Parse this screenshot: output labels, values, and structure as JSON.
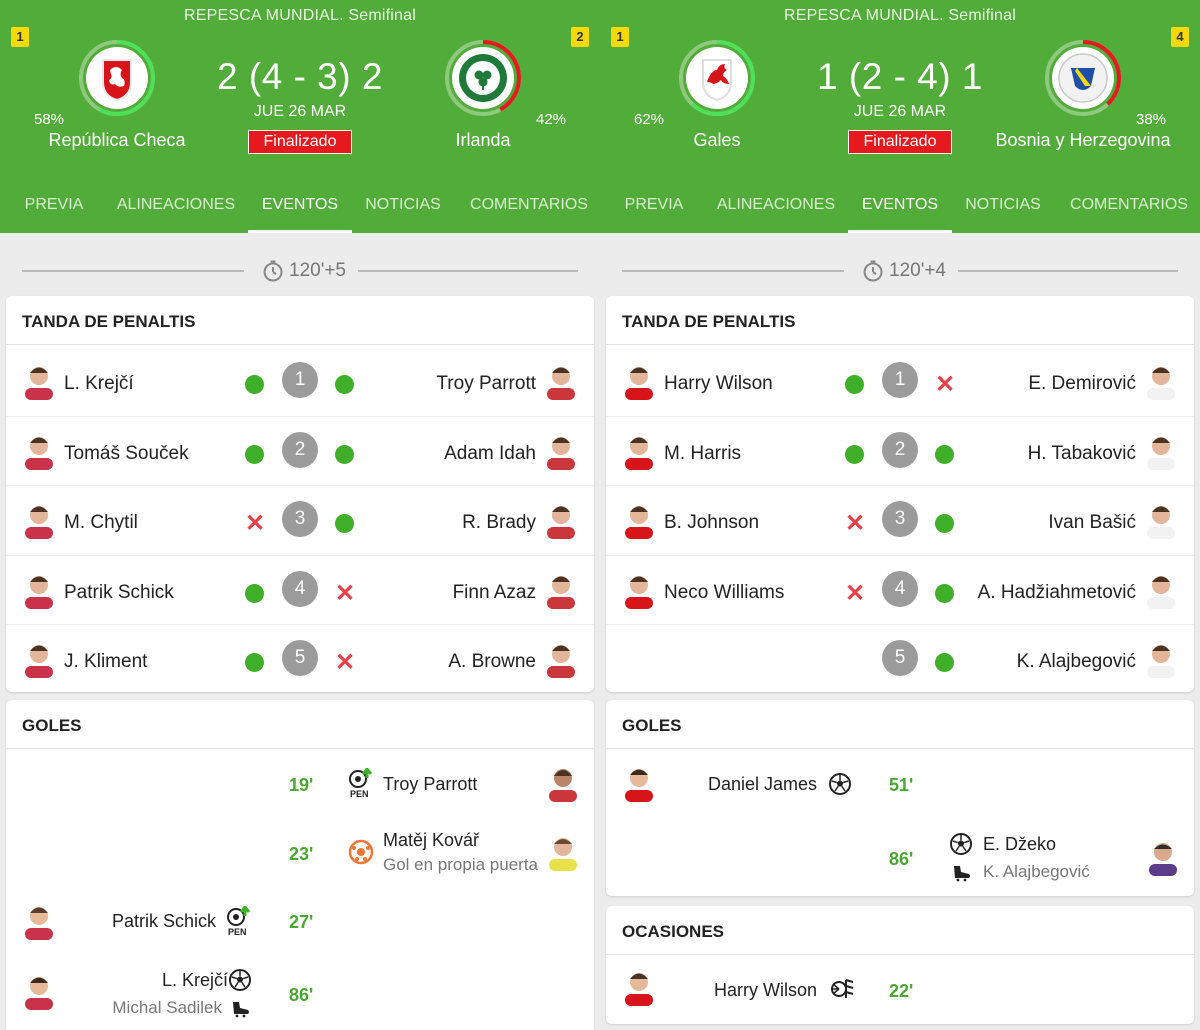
{
  "panels": [
    {
      "competition": "REPESCA MUNDIAL. Semifinal",
      "home": {
        "rank": "1",
        "pct": "58%",
        "name": "República Checa",
        "win_share": 0.58
      },
      "away": {
        "rank": "2",
        "pct": "42%",
        "name": "Irlanda",
        "win_share": 0.42
      },
      "score": "2 (4 - 3) 2",
      "date": "JUE 26 MAR",
      "status": "Finalizado",
      "tabs": [
        "PREVIA",
        "ALINEACIONES",
        "EVENTOS",
        "NOTICIAS",
        "COMENTARIOS"
      ],
      "active_tab": "EVENTOS",
      "timer": "120'+5",
      "penalties": {
        "title": "TANDA DE PENALTIS",
        "rows": [
          {
            "num": "1",
            "home": "L. Krejčí",
            "home_result": "scored",
            "away": "Troy Parrott",
            "away_result": "scored"
          },
          {
            "num": "2",
            "home": "Tomáš Souček",
            "home_result": "scored",
            "away": "Adam Idah",
            "away_result": "scored"
          },
          {
            "num": "3",
            "home": "M. Chytil",
            "home_result": "missed",
            "away": "R. Brady",
            "away_result": "scored"
          },
          {
            "num": "4",
            "home": "Patrik Schick",
            "home_result": "scored",
            "away": "Finn Azaz",
            "away_result": "missed"
          },
          {
            "num": "5",
            "home": "J. Kliment",
            "home_result": "scored",
            "away": "A. Browne",
            "away_result": "missed"
          }
        ]
      },
      "goals": {
        "title": "GOLES",
        "rows": [
          {
            "minute": "19'",
            "side": "away",
            "player": "Troy Parrott",
            "icon": "penalty-goal-icon"
          },
          {
            "minute": "23'",
            "side": "away",
            "player": "Matěj Kovář",
            "sub": "Gol en propia puerta",
            "icon": "own-goal-icon"
          },
          {
            "minute": "27'",
            "side": "home",
            "player": "Patrik Schick",
            "icon": "penalty-goal-icon"
          },
          {
            "minute": "86'",
            "side": "home",
            "player": "L. Krejčí",
            "sub": "Michal Sadilek",
            "icon": "goal-ball-icon"
          }
        ]
      }
    },
    {
      "competition": "REPESCA MUNDIAL. Semifinal",
      "home": {
        "rank": "1",
        "pct": "62%",
        "name": "Gales",
        "win_share": 0.62
      },
      "away": {
        "rank": "4",
        "pct": "38%",
        "name": "Bosnia y Herzegovina",
        "win_share": 0.38
      },
      "score": "1 (2 - 4) 1",
      "date": "JUE 26 MAR",
      "status": "Finalizado",
      "tabs": [
        "PREVIA",
        "ALINEACIONES",
        "EVENTOS",
        "NOTICIAS",
        "COMENTARIOS"
      ],
      "active_tab": "EVENTOS",
      "timer": "120'+4",
      "penalties": {
        "title": "TANDA DE PENALTIS",
        "rows": [
          {
            "num": "1",
            "home": "Harry Wilson",
            "home_result": "scored",
            "away": "E. Demirović",
            "away_result": "missed"
          },
          {
            "num": "2",
            "home": "M. Harris",
            "home_result": "scored",
            "away": "H. Tabaković",
            "away_result": "scored"
          },
          {
            "num": "3",
            "home": "B. Johnson",
            "home_result": "missed",
            "away": "Ivan Bašić",
            "away_result": "scored"
          },
          {
            "num": "4",
            "home": "Neco Williams",
            "home_result": "missed",
            "away": "A. Hadžiahmetović",
            "away_result": "scored"
          },
          {
            "num": "5",
            "home": "",
            "home_result": "none",
            "away": "K. Alajbegović",
            "away_result": "scored"
          }
        ]
      },
      "goals": {
        "title": "GOLES",
        "rows": [
          {
            "minute": "51'",
            "side": "home",
            "player": "Daniel James",
            "icon": "goal-ball-icon"
          },
          {
            "minute": "86'",
            "side": "away",
            "player": "E. Džeko",
            "sub": "K. Alajbegović",
            "icon": "goal-ball-icon"
          }
        ]
      },
      "chances": {
        "title": "OCASIONES",
        "rows": [
          {
            "minute": "22'",
            "side": "home",
            "player": "Harry Wilson",
            "icon": "chance-icon"
          }
        ]
      }
    }
  ],
  "colors": {
    "header_green": "#52ac3a",
    "accent_green": "#3fae29",
    "miss_red": "#e8404a",
    "status_red": "#e5191e",
    "rank_yellow": "#f5d90a",
    "number_grey": "#9b9b9b"
  }
}
